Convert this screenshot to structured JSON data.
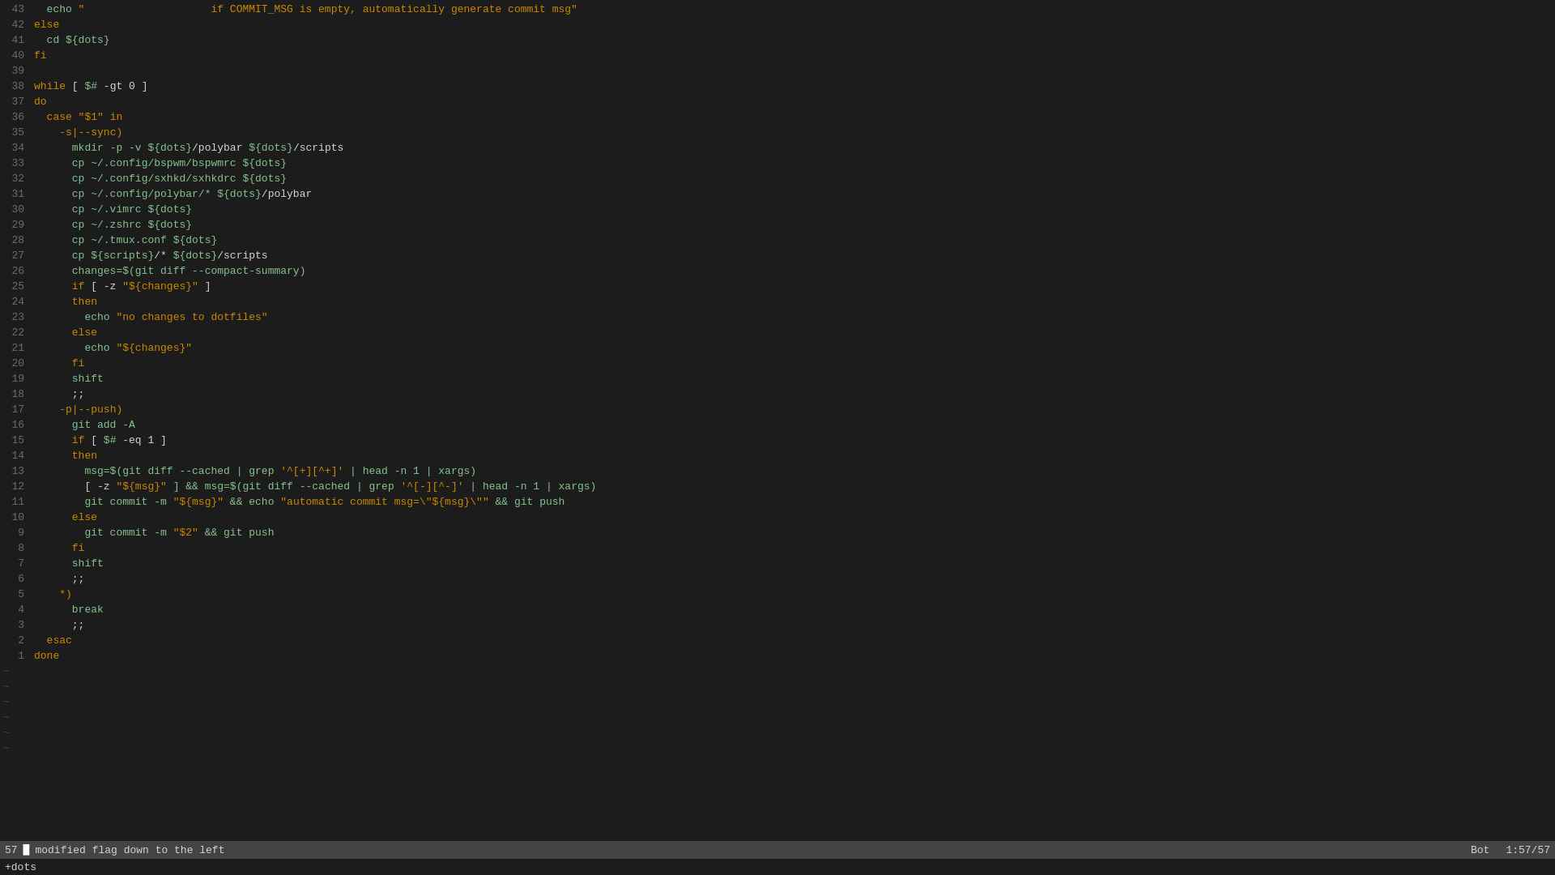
{
  "editor": {
    "lines": [
      {
        "num": "43",
        "tokens": [
          {
            "t": "  echo ",
            "c": "c-cmd"
          },
          {
            "t": "\"                    if COMMIT_MSG is empty, automatically generate commit msg\"",
            "c": "c-comment"
          }
        ]
      },
      {
        "num": "42",
        "tokens": [
          {
            "t": "else",
            "c": "c-keyword"
          }
        ]
      },
      {
        "num": "41",
        "tokens": [
          {
            "t": "  cd ",
            "c": "c-cmd"
          },
          {
            "t": "${dots}",
            "c": "c-var"
          }
        ]
      },
      {
        "num": "40",
        "tokens": [
          {
            "t": "fi",
            "c": "c-keyword"
          }
        ]
      },
      {
        "num": "39",
        "tokens": []
      },
      {
        "num": "38",
        "tokens": [
          {
            "t": "while ",
            "c": "c-keyword"
          },
          {
            "t": "[ ",
            "c": "c-bracket"
          },
          {
            "t": "$#",
            "c": "c-var"
          },
          {
            "t": " -gt 0 ]",
            "c": "c-punct"
          }
        ]
      },
      {
        "num": "37",
        "tokens": [
          {
            "t": "do",
            "c": "c-keyword"
          }
        ]
      },
      {
        "num": "36",
        "tokens": [
          {
            "t": "  case ",
            "c": "c-keyword"
          },
          {
            "t": "\"$1\"",
            "c": "c-comment"
          },
          {
            "t": " in",
            "c": "c-keyword"
          }
        ]
      },
      {
        "num": "35",
        "tokens": [
          {
            "t": "    ",
            "c": ""
          },
          {
            "t": "-s|--sync)",
            "c": "c-keyword"
          }
        ]
      },
      {
        "num": "34",
        "tokens": [
          {
            "t": "      mkdir ",
            "c": "c-cmd"
          },
          {
            "t": "-p -v ",
            "c": "c-flag"
          },
          {
            "t": "${dots}",
            "c": "c-var"
          },
          {
            "t": "/polybar ",
            "c": "c-punct"
          },
          {
            "t": "${dots}",
            "c": "c-var"
          },
          {
            "t": "/scripts",
            "c": "c-punct"
          }
        ]
      },
      {
        "num": "33",
        "tokens": [
          {
            "t": "      cp ",
            "c": "c-cmd"
          },
          {
            "t": "~/.config/bspwm/bspwmrc ",
            "c": "c-tilde"
          },
          {
            "t": "${dots}",
            "c": "c-var"
          }
        ]
      },
      {
        "num": "32",
        "tokens": [
          {
            "t": "      cp ",
            "c": "c-cmd"
          },
          {
            "t": "~/.config/sxhkd/sxhkdrc ",
            "c": "c-tilde"
          },
          {
            "t": "${dots}",
            "c": "c-var"
          }
        ]
      },
      {
        "num": "31",
        "tokens": [
          {
            "t": "      cp ",
            "c": "c-cmd"
          },
          {
            "t": "~/.config/polybar/* ",
            "c": "c-tilde"
          },
          {
            "t": "${dots}",
            "c": "c-var"
          },
          {
            "t": "/polybar",
            "c": "c-punct"
          }
        ]
      },
      {
        "num": "30",
        "tokens": [
          {
            "t": "      cp ",
            "c": "c-cmd"
          },
          {
            "t": "~/.vimrc ",
            "c": "c-tilde"
          },
          {
            "t": "${dots}",
            "c": "c-var"
          }
        ]
      },
      {
        "num": "29",
        "tokens": [
          {
            "t": "      cp ",
            "c": "c-cmd"
          },
          {
            "t": "~/.zshrc ",
            "c": "c-tilde"
          },
          {
            "t": "${dots}",
            "c": "c-var"
          }
        ]
      },
      {
        "num": "28",
        "tokens": [
          {
            "t": "      cp ",
            "c": "c-cmd"
          },
          {
            "t": "~/.tmux.conf ",
            "c": "c-tilde"
          },
          {
            "t": "${dots}",
            "c": "c-var"
          }
        ]
      },
      {
        "num": "27",
        "tokens": [
          {
            "t": "      cp ",
            "c": "c-cmd"
          },
          {
            "t": "${scripts}",
            "c": "c-var"
          },
          {
            "t": "/* ",
            "c": "c-punct"
          },
          {
            "t": "${dots}",
            "c": "c-var"
          },
          {
            "t": "/scripts",
            "c": "c-punct"
          }
        ]
      },
      {
        "num": "26",
        "tokens": [
          {
            "t": "      changes=$(git diff --compact-summary)",
            "c": "c-cmd"
          }
        ]
      },
      {
        "num": "25",
        "tokens": [
          {
            "t": "      if ",
            "c": "c-keyword"
          },
          {
            "t": "[ -z ",
            "c": "c-bracket"
          },
          {
            "t": "\"${changes}\"",
            "c": "c-comment"
          },
          {
            "t": " ]",
            "c": "c-bracket"
          }
        ]
      },
      {
        "num": "24",
        "tokens": [
          {
            "t": "      then",
            "c": "c-keyword"
          }
        ]
      },
      {
        "num": "23",
        "tokens": [
          {
            "t": "        echo ",
            "c": "c-cmd"
          },
          {
            "t": "\"no changes to dotfiles\"",
            "c": "c-comment"
          }
        ]
      },
      {
        "num": "22",
        "tokens": [
          {
            "t": "      else",
            "c": "c-keyword"
          }
        ]
      },
      {
        "num": "21",
        "tokens": [
          {
            "t": "        echo ",
            "c": "c-cmd"
          },
          {
            "t": "\"${changes}\"",
            "c": "c-comment"
          }
        ]
      },
      {
        "num": "20",
        "tokens": [
          {
            "t": "      fi",
            "c": "c-keyword"
          }
        ]
      },
      {
        "num": "19",
        "tokens": [
          {
            "t": "      shift",
            "c": "c-cmd"
          }
        ]
      },
      {
        "num": "18",
        "tokens": [
          {
            "t": "      ;;",
            "c": "c-punct"
          }
        ]
      },
      {
        "num": "17",
        "tokens": [
          {
            "t": "    ",
            "c": ""
          },
          {
            "t": "-p|--push)",
            "c": "c-keyword"
          }
        ]
      },
      {
        "num": "16",
        "tokens": [
          {
            "t": "      git add ",
            "c": "c-cmd"
          },
          {
            "t": "-A",
            "c": "c-flag"
          }
        ]
      },
      {
        "num": "15",
        "tokens": [
          {
            "t": "      if ",
            "c": "c-keyword"
          },
          {
            "t": "[ ",
            "c": "c-bracket"
          },
          {
            "t": "$#",
            "c": "c-var"
          },
          {
            "t": " -eq 1 ]",
            "c": "c-punct"
          }
        ]
      },
      {
        "num": "14",
        "tokens": [
          {
            "t": "      then",
            "c": "c-keyword"
          }
        ]
      },
      {
        "num": "13",
        "tokens": [
          {
            "t": "        msg=$(git diff --cached | grep ",
            "c": "c-cmd"
          },
          {
            "t": "'^[+][^+]'",
            "c": "c-comment"
          },
          {
            "t": " | head -n 1 | xargs)",
            "c": "c-cmd"
          }
        ]
      },
      {
        "num": "12",
        "tokens": [
          {
            "t": "        [ -z ",
            "c": "c-bracket"
          },
          {
            "t": "\"${msg}\"",
            "c": "c-comment"
          },
          {
            "t": " ] && msg=$(git diff --cached | grep ",
            "c": "c-cmd"
          },
          {
            "t": "'^[-][^-]'",
            "c": "c-comment"
          },
          {
            "t": " | head -n 1 | xargs)",
            "c": "c-cmd"
          }
        ]
      },
      {
        "num": "11",
        "tokens": [
          {
            "t": "        git commit -m ",
            "c": "c-cmd"
          },
          {
            "t": "\"${msg}\"",
            "c": "c-comment"
          },
          {
            "t": " && echo ",
            "c": "c-cmd"
          },
          {
            "t": "\"automatic commit msg=\\\"${msg}\\\"\"",
            "c": "c-comment"
          },
          {
            "t": " && git push",
            "c": "c-cmd"
          }
        ]
      },
      {
        "num": "10",
        "tokens": [
          {
            "t": "      else",
            "c": "c-keyword"
          }
        ]
      },
      {
        "num": "9",
        "tokens": [
          {
            "t": "        git commit -m ",
            "c": "c-cmd"
          },
          {
            "t": "\"$2\"",
            "c": "c-comment"
          },
          {
            "t": " && git push",
            "c": "c-cmd"
          }
        ]
      },
      {
        "num": "8",
        "tokens": [
          {
            "t": "      fi",
            "c": "c-keyword"
          }
        ]
      },
      {
        "num": "7",
        "tokens": [
          {
            "t": "      shift",
            "c": "c-cmd"
          }
        ]
      },
      {
        "num": "6",
        "tokens": [
          {
            "t": "      ;;",
            "c": "c-punct"
          }
        ]
      },
      {
        "num": "5",
        "tokens": [
          {
            "t": "    *)",
            "c": "c-keyword"
          }
        ]
      },
      {
        "num": "4",
        "tokens": [
          {
            "t": "      break",
            "c": "c-cmd"
          }
        ]
      },
      {
        "num": "3",
        "tokens": [
          {
            "t": "      ;;",
            "c": "c-punct"
          }
        ]
      },
      {
        "num": "2",
        "tokens": [
          {
            "t": "  esac",
            "c": "c-keyword"
          }
        ]
      },
      {
        "num": "1",
        "tokens": [
          {
            "t": "done",
            "c": "c-keyword"
          }
        ]
      }
    ],
    "cursor_line": "57",
    "status_line": {
      "modified_indicator": "●",
      "filename": "modified flag down to the left",
      "position": "Bot",
      "line_col": "1:57/57"
    },
    "bottom_left": "+dots",
    "tilde_lines": 6
  }
}
